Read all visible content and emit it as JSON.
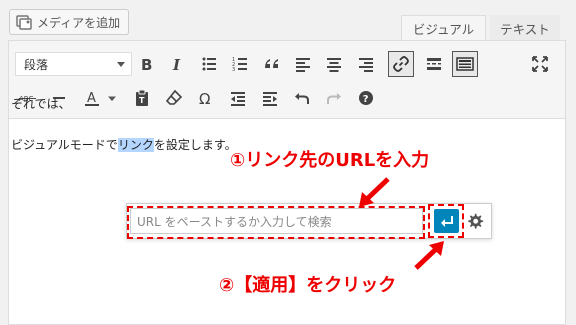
{
  "header": {
    "add_media_label": "メディアを追加"
  },
  "tabs": [
    {
      "label": "ビジュアル",
      "active": true
    },
    {
      "label": "テキスト",
      "active": false
    }
  ],
  "toolbar": {
    "format_select": "段落",
    "row1_icons": [
      "bold-icon",
      "italic-icon",
      "bullet-list-icon",
      "numbered-list-icon",
      "blockquote-icon",
      "align-left-icon",
      "align-center-icon",
      "align-right-icon",
      "insert-link-icon",
      "read-more-icon",
      "toolbar-toggle-icon",
      "fullscreen-icon"
    ],
    "row2_icons": [
      "strikethrough-icon",
      "horizontal-line-icon",
      "text-color-icon",
      "paste-as-text-icon",
      "clear-formatting-icon",
      "special-character-icon",
      "outdent-icon",
      "indent-icon",
      "undo-icon",
      "redo-icon",
      "help-icon"
    ],
    "strike_label": "ABC",
    "text_color_label": "A",
    "omega_label": "Ω",
    "help_label": "?"
  },
  "content": {
    "line1": "それでは、",
    "line2_before": "ビジュアルモードで",
    "line2_selected": "リンク",
    "line2_after": "を設定します。"
  },
  "link_popup": {
    "placeholder": "URL をペーストするか入力して検索",
    "apply_icon": "enter-icon",
    "settings_icon": "gear-icon"
  },
  "annotations": {
    "step1": "①リンク先のURLを入力",
    "step2": "②【適用】をクリック",
    "color": "#e00000"
  },
  "colors": {
    "accent": "#0085ba",
    "selection": "#b4d5fe"
  }
}
